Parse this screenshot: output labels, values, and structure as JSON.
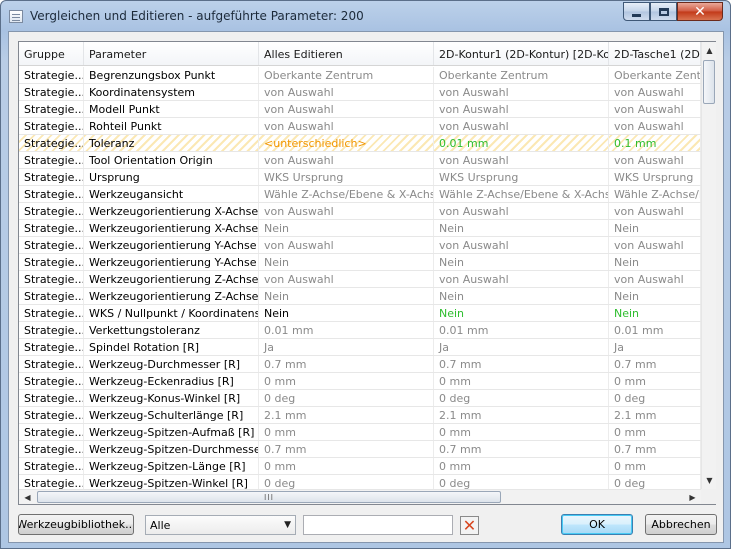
{
  "window": {
    "title": "Vergleichen und Editieren - aufgeführte Parameter: 200",
    "min_glyph": "",
    "max_glyph": "",
    "close_glyph": "✕"
  },
  "columns": [
    "Gruppe",
    "Parameter",
    "Alles Editieren",
    "2D-Kontur1 (2D-Kontur) [2D-Ko...",
    "2D-Tasche1 (2D-T"
  ],
  "rows": [
    {
      "cells": [
        "Strategie...",
        "Begrenzungsbox Punkt",
        "Oberkante Zentrum",
        "Oberkante Zentrum",
        "Oberkante Zentrum"
      ],
      "styles": [
        "black",
        "black",
        "gray",
        "gray",
        "gray"
      ]
    },
    {
      "cells": [
        "Strategie...",
        "Koordinatensystem",
        "von Auswahl",
        "von Auswahl",
        "von Auswahl"
      ],
      "styles": [
        "black",
        "black",
        "gray",
        "gray",
        "gray"
      ]
    },
    {
      "cells": [
        "Strategie...",
        "Modell Punkt",
        "von Auswahl",
        "von Auswahl",
        "von Auswahl"
      ],
      "styles": [
        "black",
        "black",
        "gray",
        "gray",
        "gray"
      ]
    },
    {
      "cells": [
        "Strategie...",
        "Rohteil Punkt",
        "von Auswahl",
        "von Auswahl",
        "von Auswahl"
      ],
      "styles": [
        "black",
        "black",
        "gray",
        "gray",
        "gray"
      ]
    },
    {
      "cells": [
        "Strategie...",
        "Toleranz",
        "<unterschiedlich>",
        "0.01 mm",
        "0.1 mm"
      ],
      "styles": [
        "black",
        "black",
        "orange",
        "green",
        "green"
      ],
      "hatched": true
    },
    {
      "cells": [
        "Strategie...",
        "Tool Orientation Origin",
        "von Auswahl",
        "von Auswahl",
        "von Auswahl"
      ],
      "styles": [
        "black",
        "black",
        "gray",
        "gray",
        "gray"
      ]
    },
    {
      "cells": [
        "Strategie...",
        "Ursprung",
        "WKS Ursprung",
        "WKS Ursprung",
        "WKS Ursprung"
      ],
      "styles": [
        "black",
        "black",
        "gray",
        "gray",
        "gray"
      ]
    },
    {
      "cells": [
        "Strategie...",
        "Werkzeugansicht",
        "Wähle Z-Achse/Ebene & X-Achse",
        "Wähle Z-Achse/Ebene & X-Achse",
        "Wähle Z-Achse/Eb"
      ],
      "styles": [
        "black",
        "black",
        "gray",
        "gray",
        "gray"
      ]
    },
    {
      "cells": [
        "Strategie...",
        "Werkzeugorientierung X-Achse",
        "von Auswahl",
        "von Auswahl",
        "von Auswahl"
      ],
      "styles": [
        "black",
        "black",
        "gray",
        "gray",
        "gray"
      ]
    },
    {
      "cells": [
        "Strategie...",
        "Werkzeugorientierung X-Achse ...",
        "Nein",
        "Nein",
        "Nein"
      ],
      "styles": [
        "black",
        "black",
        "gray",
        "gray",
        "gray"
      ]
    },
    {
      "cells": [
        "Strategie...",
        "Werkzeugorientierung Y-Achse",
        "von Auswahl",
        "von Auswahl",
        "von Auswahl"
      ],
      "styles": [
        "black",
        "black",
        "gray",
        "gray",
        "gray"
      ]
    },
    {
      "cells": [
        "Strategie...",
        "Werkzeugorientierung Y-Achse ...",
        "Nein",
        "Nein",
        "Nein"
      ],
      "styles": [
        "black",
        "black",
        "gray",
        "gray",
        "gray"
      ]
    },
    {
      "cells": [
        "Strategie...",
        "Werkzeugorientierung Z-Achse",
        "von Auswahl",
        "von Auswahl",
        "von Auswahl"
      ],
      "styles": [
        "black",
        "black",
        "gray",
        "gray",
        "gray"
      ]
    },
    {
      "cells": [
        "Strategie...",
        "Werkzeugorientierung Z-Achse ...",
        "Nein",
        "Nein",
        "Nein"
      ],
      "styles": [
        "black",
        "black",
        "gray",
        "gray",
        "gray"
      ]
    },
    {
      "cells": [
        "Strategie...",
        "WKS / Nullpunkt / Koordinatens...",
        "Nein",
        "Nein",
        "Nein"
      ],
      "styles": [
        "black",
        "black",
        "black",
        "green",
        "green"
      ]
    },
    {
      "cells": [
        "Strategie...",
        "Verkettungstoleranz",
        "0.01 mm",
        "0.01 mm",
        "0.01 mm"
      ],
      "styles": [
        "black",
        "black",
        "gray",
        "gray",
        "gray"
      ]
    },
    {
      "cells": [
        "Strategie...",
        "Spindel Rotation [R]",
        "Ja",
        "Ja",
        "Ja"
      ],
      "styles": [
        "black",
        "black",
        "gray",
        "gray",
        "gray"
      ]
    },
    {
      "cells": [
        "Strategie...",
        "Werkzeug-Durchmesser [R]",
        "0.7 mm",
        "0.7 mm",
        "0.7 mm"
      ],
      "styles": [
        "black",
        "black",
        "gray",
        "gray",
        "gray"
      ]
    },
    {
      "cells": [
        "Strategie...",
        "Werkzeug-Eckenradius [R]",
        "0 mm",
        "0 mm",
        "0 mm"
      ],
      "styles": [
        "black",
        "black",
        "gray",
        "gray",
        "gray"
      ]
    },
    {
      "cells": [
        "Strategie...",
        "Werkzeug-Konus-Winkel [R]",
        "0 deg",
        "0 deg",
        "0 deg"
      ],
      "styles": [
        "black",
        "black",
        "gray",
        "gray",
        "gray"
      ]
    },
    {
      "cells": [
        "Strategie...",
        "Werkzeug-Schulterlänge [R]",
        "2.1 mm",
        "2.1 mm",
        "2.1 mm"
      ],
      "styles": [
        "black",
        "black",
        "gray",
        "gray",
        "gray"
      ]
    },
    {
      "cells": [
        "Strategie...",
        "Werkzeug-Spitzen-Aufmaß [R]",
        "0 mm",
        "0 mm",
        "0 mm"
      ],
      "styles": [
        "black",
        "black",
        "gray",
        "gray",
        "gray"
      ]
    },
    {
      "cells": [
        "Strategie...",
        "Werkzeug-Spitzen-Durchmesse...",
        "0.7 mm",
        "0.7 mm",
        "0.7 mm"
      ],
      "styles": [
        "black",
        "black",
        "gray",
        "gray",
        "gray"
      ]
    },
    {
      "cells": [
        "Strategie...",
        "Werkzeug-Spitzen-Länge [R]",
        "0 mm",
        "0 mm",
        "0 mm"
      ],
      "styles": [
        "black",
        "black",
        "gray",
        "gray",
        "gray"
      ]
    },
    {
      "cells": [
        "Strategie...",
        "Werkzeug-Spitzen-Winkel [R]",
        "0 deg",
        "0 deg",
        "0 deg"
      ],
      "styles": [
        "black",
        "black",
        "gray",
        "gray",
        "gray"
      ]
    }
  ],
  "scroll": {
    "up_arrow": "▲",
    "down_arrow": "▼",
    "left_arrow": "◀",
    "right_arrow": "▶",
    "grip": "III"
  },
  "footer": {
    "library_button": "Werkzeugbibliothek...",
    "filter_select_value": "Alle",
    "filter_select_arrow": "▼",
    "search_value": "",
    "clear_glyph": "✕",
    "ok_button": "OK",
    "cancel_button": "Abbrechen"
  },
  "colors": {
    "changed_value": "#2ebd2e",
    "varying_value": "#f29600",
    "inherited_value": "#8a8a8a",
    "clear_icon": "#d8461f"
  }
}
